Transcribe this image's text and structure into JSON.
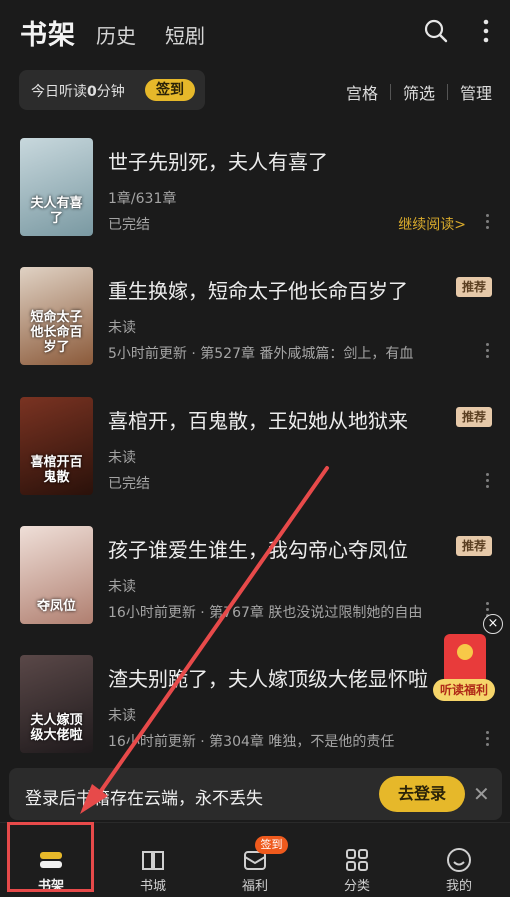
{
  "header": {
    "tabs": [
      {
        "label": "书架",
        "active": true
      },
      {
        "label": "历史",
        "active": false
      },
      {
        "label": "短剧",
        "active": false
      }
    ],
    "icons": [
      "search-icon",
      "more-vertical-icon"
    ]
  },
  "listen_bar": {
    "prefix": "今日听读",
    "minutes": "0",
    "suffix": "分钟",
    "checkin_label": "签到"
  },
  "sub_links": [
    "宫格",
    "筛选",
    "管理"
  ],
  "books": [
    {
      "title": "世子先别死，夫人有喜了",
      "line2": "1章/631章",
      "line3": "已完结",
      "badge": "",
      "action": "继续阅读>",
      "cover_text": "夫人有喜了",
      "cover_colors": [
        "#bfcfd6",
        "#6d8c96"
      ]
    },
    {
      "title": "重生换嫁，短命太子他长命百岁了",
      "line2": "未读",
      "line3": "5小时前更新 · 第527章 番外咸城篇：剑上，有血",
      "badge": "推荐",
      "action": "",
      "cover_text": "短命太子他长命百岁了",
      "cover_colors": [
        "#d7c7b8",
        "#8b5a3a"
      ]
    },
    {
      "title": "喜棺开，百鬼散，王妃她从地狱来",
      "line2": "未读",
      "line3": "已完结",
      "badge": "推荐",
      "action": "",
      "cover_text": "喜棺开百鬼散",
      "cover_colors": [
        "#6b2a1c",
        "#2a110a"
      ]
    },
    {
      "title": "孩子谁爱生谁生，我勾帝心夺凤位",
      "line2": "未读",
      "line3": "16小时前更新 · 第767章 朕也没说过限制她的自由",
      "badge": "推荐",
      "action": "",
      "cover_text": "夺凤位",
      "cover_colors": [
        "#e9d6ce",
        "#b07f70"
      ]
    },
    {
      "title": "渣夫别跪了，夫人嫁顶级大佬显怀啦",
      "line2": "未读",
      "line3": "16小时前更新 · 第304章 唯独，不是他的责任",
      "badge": "",
      "action": "",
      "cover_text": "夫人嫁顶级大佬啦",
      "cover_colors": [
        "#4a3a3a",
        "#1f1a1c"
      ]
    }
  ],
  "float_widget": {
    "label": "听读福利",
    "close": "×"
  },
  "login_banner": {
    "text": "登录后书籍存在云端，永不丢失",
    "button": "去登录",
    "close": "✕"
  },
  "bottom_nav": [
    {
      "label": "书架",
      "icon": "bookshelf-icon",
      "active": true
    },
    {
      "label": "书城",
      "icon": "book-store-icon",
      "active": false
    },
    {
      "label": "福利",
      "icon": "welfare-icon",
      "active": false,
      "badge": "签到"
    },
    {
      "label": "分类",
      "icon": "category-grid-icon",
      "active": false
    },
    {
      "label": "我的",
      "icon": "profile-icon",
      "active": false
    }
  ],
  "colors": {
    "accent": "#e6b82a",
    "background": "#1b1b1b",
    "annotation": "#e74a4a"
  }
}
